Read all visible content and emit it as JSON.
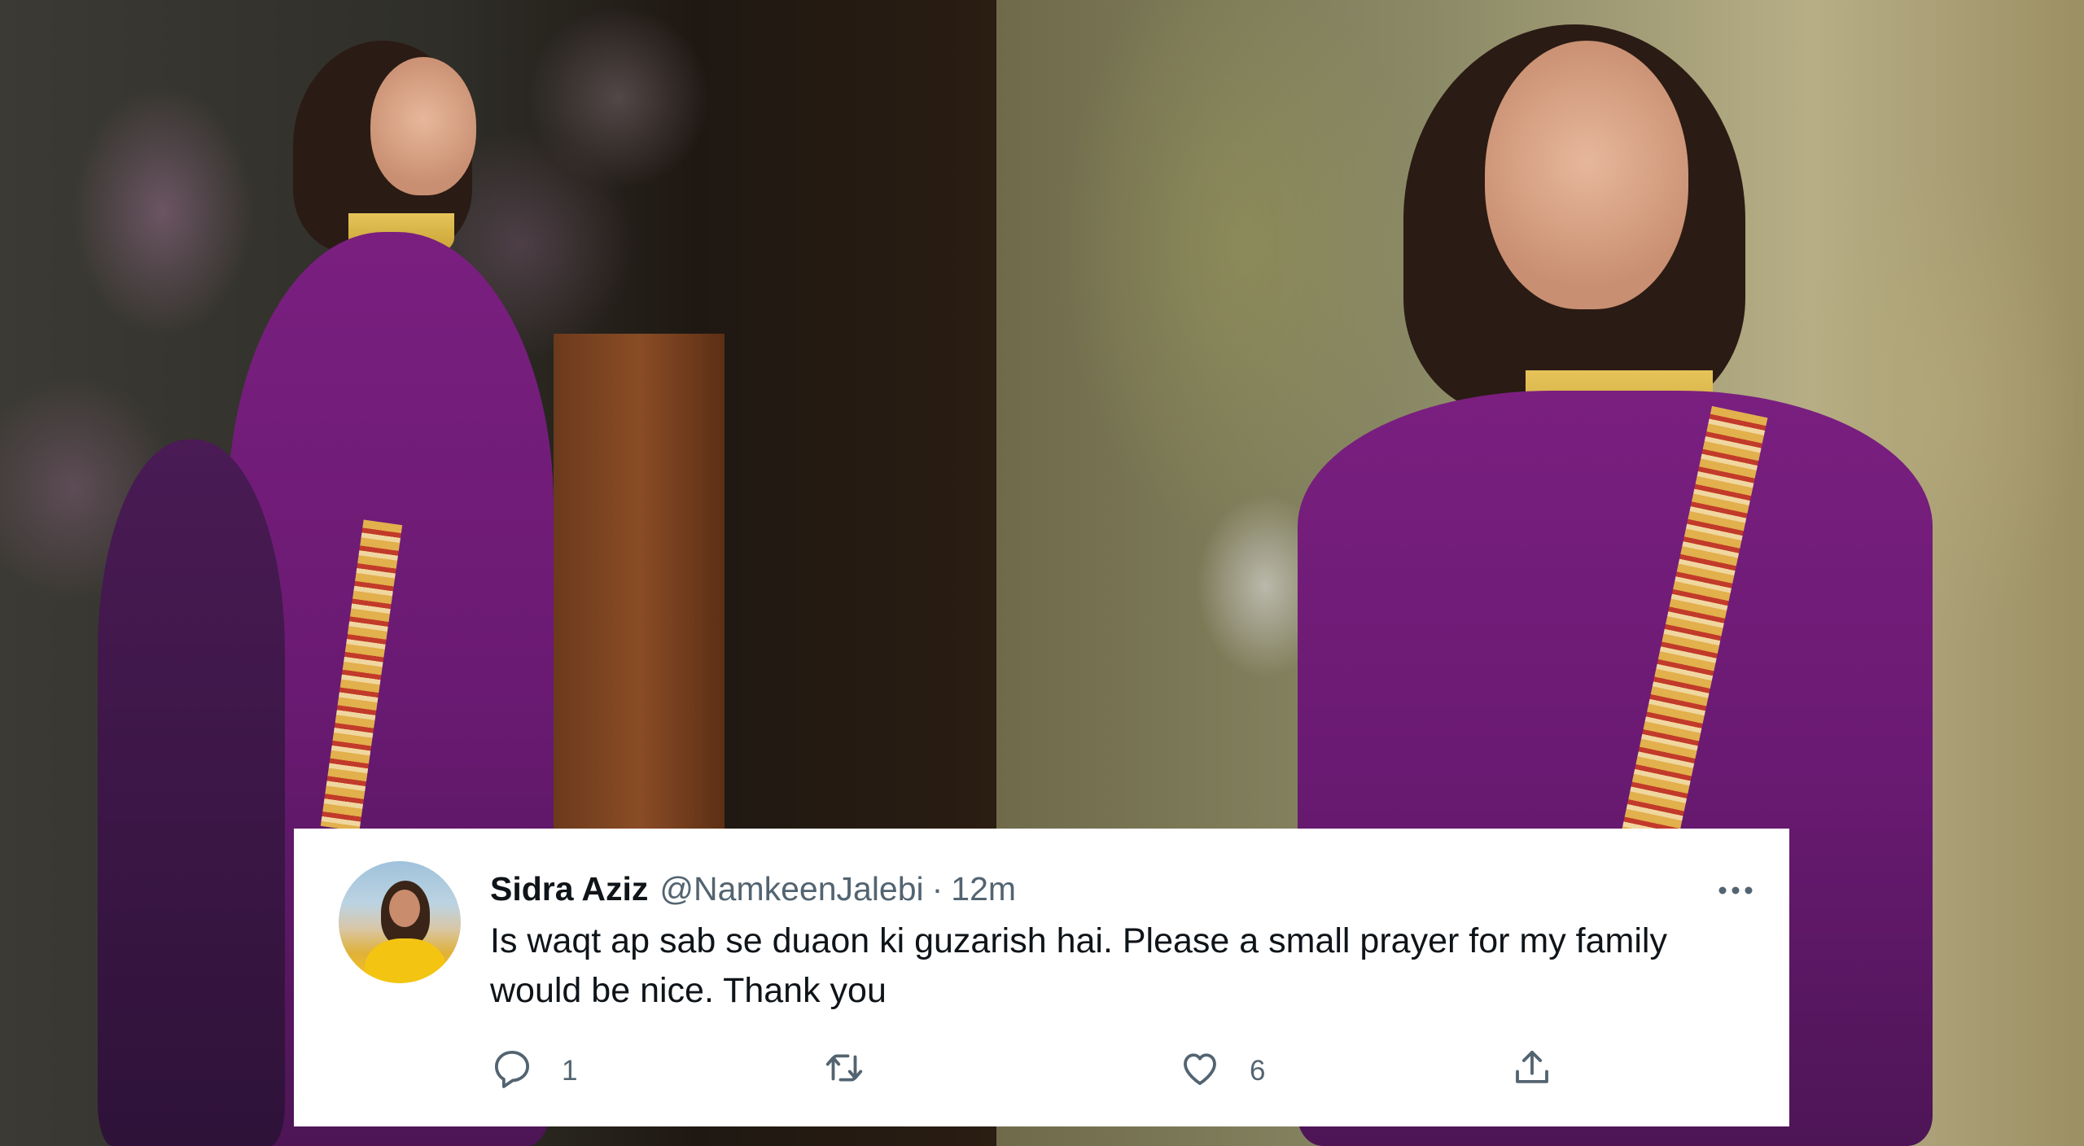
{
  "tweet": {
    "display_name": "Sidra Aziz",
    "handle": "@NamkeenJalebi",
    "separator": "·",
    "time": "12m",
    "more_icon": "more-options-icon",
    "text": "Is waqt ap sab se duaon ki guzarish hai. Please a small prayer for my family would be nice. Thank you",
    "actions": {
      "reply": {
        "icon": "reply-icon",
        "count": "1"
      },
      "retweet": {
        "icon": "retweet-icon",
        "count": ""
      },
      "like": {
        "icon": "heart-icon",
        "count": "6"
      },
      "share": {
        "icon": "share-icon",
        "count": ""
      }
    }
  },
  "colors": {
    "card_background": "#ffffff",
    "name_text": "#0f1419",
    "secondary_text": "#536471",
    "dress_purple": "#6a1a72"
  }
}
